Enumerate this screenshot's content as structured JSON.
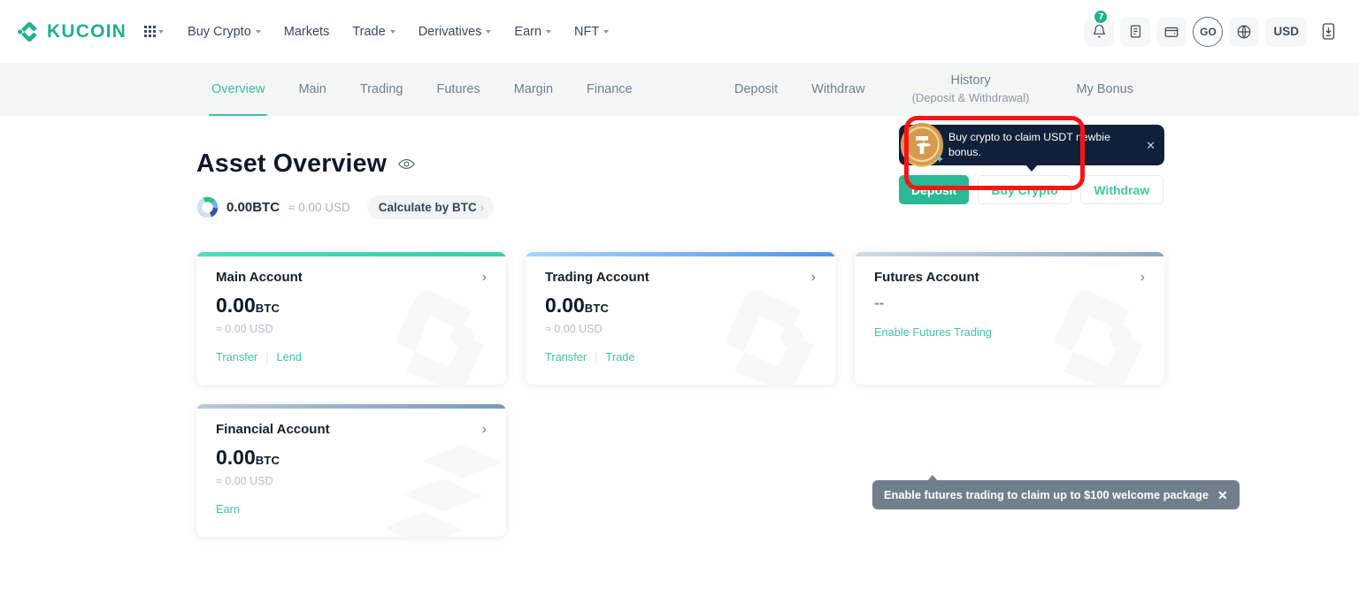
{
  "brand": {
    "name": "KUCOIN",
    "logo_icon": "kucoin-logo-icon",
    "accent_green": "#23af91"
  },
  "header": {
    "apps_icon": "apps-grid-icon",
    "nav": [
      {
        "label": "Buy Crypto",
        "has_caret": true
      },
      {
        "label": "Markets",
        "has_caret": false
      },
      {
        "label": "Trade",
        "has_caret": true
      },
      {
        "label": "Derivatives",
        "has_caret": true
      },
      {
        "label": "Earn",
        "has_caret": true
      },
      {
        "label": "NFT",
        "has_caret": true
      }
    ],
    "right": {
      "notification_icon": "bell-icon",
      "notification_count": "7",
      "orders_icon": "document-icon",
      "wallet_icon": "wallet-icon",
      "avatar_label": "GO",
      "language_icon": "globe-icon",
      "currency_label": "USD",
      "download_icon": "download-app-icon"
    }
  },
  "subnav": {
    "tabs": [
      {
        "label": "Overview",
        "active": true
      },
      {
        "label": "Main",
        "active": false
      },
      {
        "label": "Trading",
        "active": false
      },
      {
        "label": "Futures",
        "active": false
      },
      {
        "label": "Margin",
        "active": false
      },
      {
        "label": "Finance",
        "active": false
      }
    ],
    "actions": [
      {
        "label": "Deposit"
      },
      {
        "label": "Withdraw"
      }
    ],
    "history": {
      "label": "History",
      "sublabel": "(Deposit & Withdrawal)",
      "highlight_color": "#f71414"
    },
    "bonus": {
      "label": "My Bonus"
    }
  },
  "overview": {
    "title": "Asset Overview",
    "eye_icon": "eye-visibility-icon",
    "donut_icon": "donut-chart-icon",
    "balance_btc": "0.00BTC",
    "balance_usd": "≈ 0.00 USD",
    "calculate_label": "Calculate by BTC",
    "calculate_chevron": "chevron-right-icon"
  },
  "promo": {
    "coin_icon": "tether-coin-icon",
    "text": "Buy crypto to claim USDT newbie bonus.",
    "close_icon": "close-icon",
    "buttons": [
      {
        "label": "Deposit",
        "style": "primary"
      },
      {
        "label": "Buy Crypto",
        "style": "ghost"
      },
      {
        "label": "Withdraw",
        "style": "ghost"
      }
    ]
  },
  "accounts": [
    {
      "title": "Main Account",
      "amount": "0.00",
      "unit": "BTC",
      "usd": "≈ 0.00 USD",
      "links": [
        "Transfer",
        "Lend"
      ],
      "strip": "green",
      "watermark": "kucoin-k-watermark",
      "chevron_icon": "chevron-right-icon"
    },
    {
      "title": "Trading Account",
      "amount": "0.00",
      "unit": "BTC",
      "usd": "≈ 0.00 USD",
      "links": [
        "Transfer",
        "Trade"
      ],
      "strip": "blue",
      "watermark": "kucoin-k-watermark",
      "chevron_icon": "chevron-right-icon"
    },
    {
      "title": "Futures Account",
      "amount": "--",
      "unit": "",
      "usd": "",
      "links": [
        "Enable Futures Trading"
      ],
      "strip": "gray",
      "watermark": "kucoin-k-watermark",
      "chevron_icon": "chevron-right-icon"
    },
    {
      "title": "Financial Account",
      "amount": "0.00",
      "unit": "BTC",
      "usd": "≈ 0.00 USD",
      "links": [
        "Earn"
      ],
      "strip": "steel",
      "watermark": "stacked-coins-watermark",
      "chevron_icon": "chevron-right-icon"
    }
  ],
  "futures_tooltip": {
    "text": "Enable futures trading to claim up to $100 welcome package",
    "close_icon": "close-icon"
  }
}
